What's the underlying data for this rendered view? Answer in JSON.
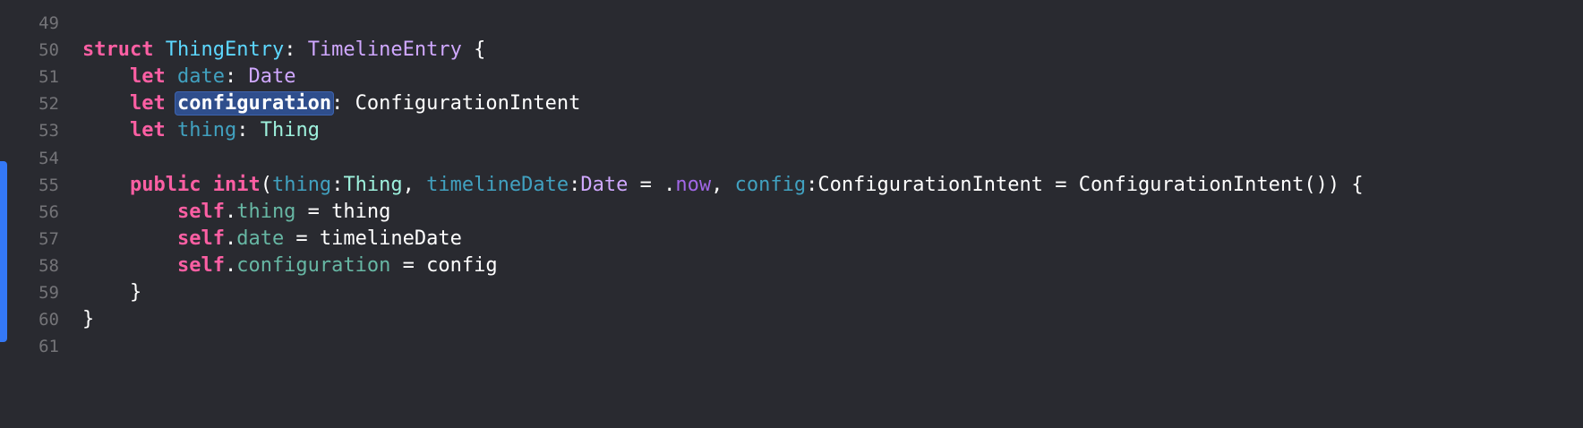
{
  "editor": {
    "language": "Swift",
    "colors": {
      "background": "#292a30",
      "keyword": "#fc5fa3",
      "type_declaration": "#5dd8ff",
      "type_reference": "#d0a8ff",
      "project_type": "#9ef1dd",
      "property": "#41a1c0",
      "line_number": "#747478",
      "change_bar": "#3478f6",
      "selection": "#2f4e8c"
    },
    "lines": [
      {
        "num": "49",
        "tokens": []
      },
      {
        "num": "50",
        "tokens": [
          {
            "t": "struct",
            "c": "kw"
          },
          {
            "t": " ",
            "c": "plain"
          },
          {
            "t": "ThingEntry",
            "c": "typedecl"
          },
          {
            "t": ": ",
            "c": "plain"
          },
          {
            "t": "TimelineEntry",
            "c": "type"
          },
          {
            "t": " {",
            "c": "plain"
          }
        ]
      },
      {
        "num": "51",
        "tokens": [
          {
            "t": "    ",
            "c": "plain"
          },
          {
            "t": "let",
            "c": "kw"
          },
          {
            "t": " ",
            "c": "plain"
          },
          {
            "t": "date",
            "c": "prop"
          },
          {
            "t": ": ",
            "c": "plain"
          },
          {
            "t": "Date",
            "c": "type"
          }
        ]
      },
      {
        "num": "52",
        "tokens": [
          {
            "t": "    ",
            "c": "plain"
          },
          {
            "t": "let",
            "c": "kw"
          },
          {
            "t": " ",
            "c": "plain"
          },
          {
            "t": "configuration",
            "c": "sel"
          },
          {
            "t": ": ConfigurationIntent",
            "c": "plain"
          }
        ]
      },
      {
        "num": "53",
        "tokens": [
          {
            "t": "    ",
            "c": "plain"
          },
          {
            "t": "let",
            "c": "kw"
          },
          {
            "t": " ",
            "c": "plain"
          },
          {
            "t": "thing",
            "c": "prop"
          },
          {
            "t": ": ",
            "c": "plain"
          },
          {
            "t": "Thing",
            "c": "typeproj"
          }
        ]
      },
      {
        "num": "54",
        "tokens": []
      },
      {
        "num": "55",
        "tokens": [
          {
            "t": "    ",
            "c": "plain"
          },
          {
            "t": "public",
            "c": "kw"
          },
          {
            "t": " ",
            "c": "plain"
          },
          {
            "t": "init",
            "c": "kw"
          },
          {
            "t": "(",
            "c": "plain"
          },
          {
            "t": "thing",
            "c": "prop"
          },
          {
            "t": ":",
            "c": "plain"
          },
          {
            "t": "Thing",
            "c": "typeproj"
          },
          {
            "t": ", ",
            "c": "plain"
          },
          {
            "t": "timelineDate",
            "c": "prop"
          },
          {
            "t": ":",
            "c": "plain"
          },
          {
            "t": "Date",
            "c": "type"
          },
          {
            "t": " = .",
            "c": "plain"
          },
          {
            "t": "now",
            "c": "member"
          },
          {
            "t": ", ",
            "c": "plain"
          },
          {
            "t": "config",
            "c": "prop"
          },
          {
            "t": ":ConfigurationIntent = ConfigurationIntent()) {",
            "c": "plain"
          }
        ]
      },
      {
        "num": "56",
        "tokens": [
          {
            "t": "        ",
            "c": "plain"
          },
          {
            "t": "self",
            "c": "kw"
          },
          {
            "t": ".",
            "c": "plain"
          },
          {
            "t": "thing",
            "c": "propproj"
          },
          {
            "t": " = thing",
            "c": "plain"
          }
        ]
      },
      {
        "num": "57",
        "tokens": [
          {
            "t": "        ",
            "c": "plain"
          },
          {
            "t": "self",
            "c": "kw"
          },
          {
            "t": ".",
            "c": "plain"
          },
          {
            "t": "date",
            "c": "propproj"
          },
          {
            "t": " = timelineDate",
            "c": "plain"
          }
        ]
      },
      {
        "num": "58",
        "tokens": [
          {
            "t": "        ",
            "c": "plain"
          },
          {
            "t": "self",
            "c": "kw"
          },
          {
            "t": ".",
            "c": "plain"
          },
          {
            "t": "configuration",
            "c": "propproj"
          },
          {
            "t": " = config",
            "c": "plain"
          }
        ]
      },
      {
        "num": "59",
        "tokens": [
          {
            "t": "    }",
            "c": "plain"
          }
        ]
      },
      {
        "num": "60",
        "tokens": [
          {
            "t": "}",
            "c": "plain"
          }
        ]
      },
      {
        "num": "61",
        "tokens": []
      }
    ]
  }
}
